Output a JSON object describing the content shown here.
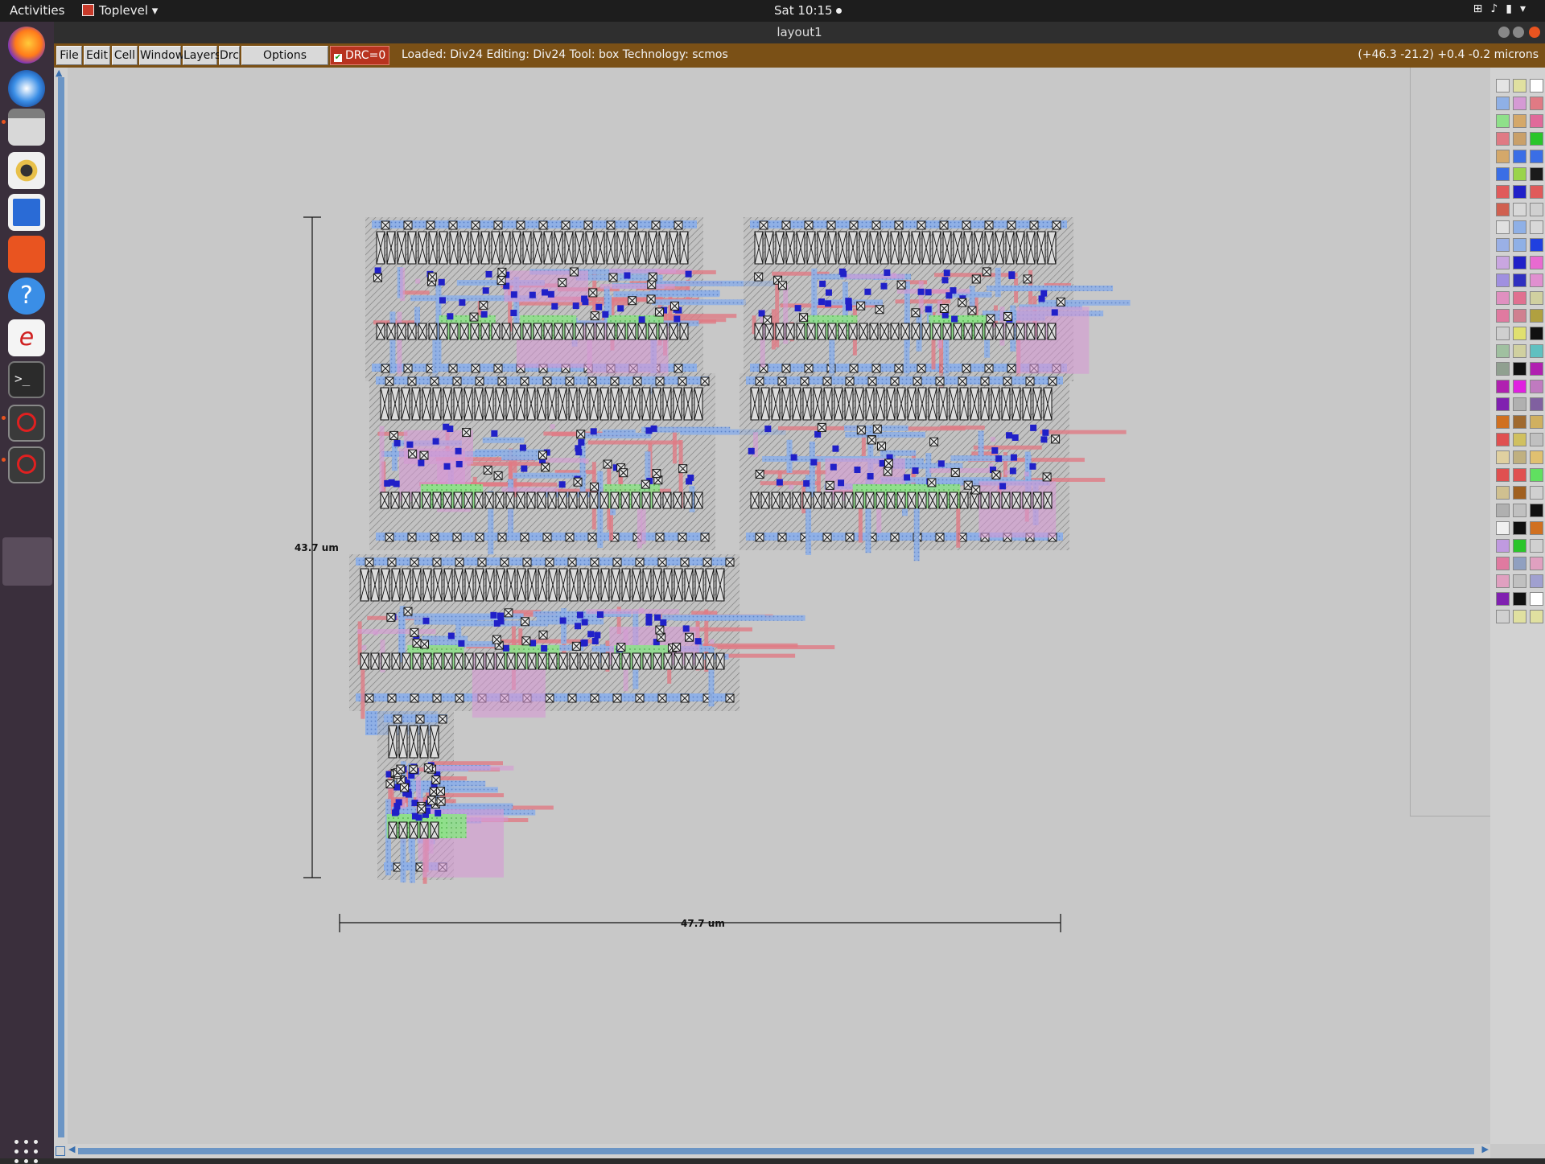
{
  "topbar": {
    "activities": "Activities",
    "app": "Toplevel",
    "clock": "Sat 10:15"
  },
  "window": {
    "title": "layout1"
  },
  "menu": [
    "File",
    "Edit",
    "Cell",
    "Window",
    "Layers",
    "Drc",
    "Options"
  ],
  "drc": "DRC=0",
  "status": "Loaded: Div24 Editing: Div24 Tool: box  Technology: scmos",
  "coords": "(+46.3 -21.2) +0.4 -0.2 microns",
  "dimensions": {
    "height": "43.7 um",
    "width": "47.7 um"
  },
  "dock_apps": [
    "firefox-icon",
    "thunderbird-icon",
    "files-icon",
    "rhythmbox-icon",
    "writer-icon",
    "software-icon",
    "help-icon",
    "electric-icon",
    "terminal-icon",
    "magic-icon",
    "magic-icon-2"
  ],
  "colors": {
    "poly": "#e07a84",
    "metal1": "#8fb0e6",
    "metal2": "#d59ad4",
    "ndiff": "#8fe08a",
    "pdiff": "#d4a86a",
    "contact": "#1a1a1a",
    "via": "#2020c8"
  }
}
